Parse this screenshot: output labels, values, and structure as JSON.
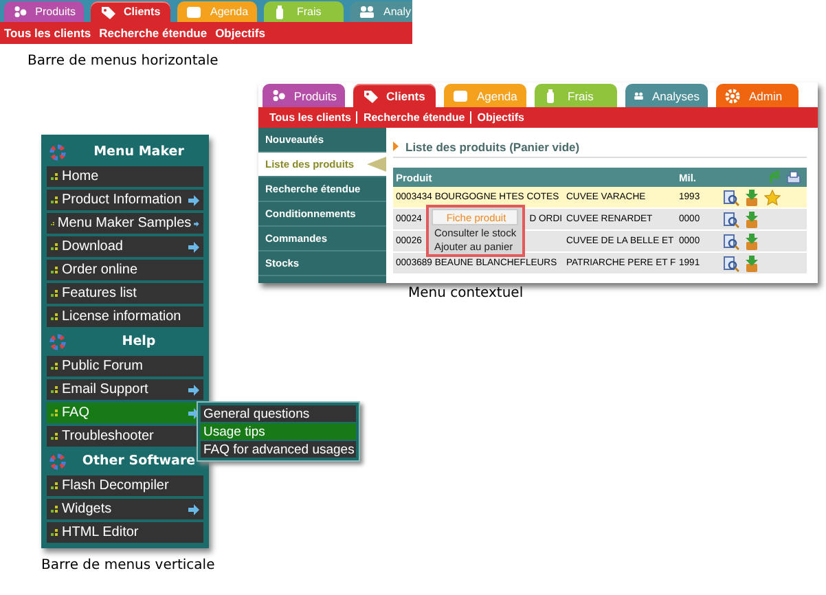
{
  "horizontal_menu": {
    "tabs": [
      {
        "label": "Produits",
        "color": "#b54ea6",
        "selected": false
      },
      {
        "label": "Clients",
        "color": "#d8282c",
        "selected": true
      },
      {
        "label": "Agenda",
        "color": "#f4a11e",
        "selected": false
      },
      {
        "label": "Frais",
        "color": "#8fc43c",
        "selected": false
      },
      {
        "label": "Analy",
        "color": "#4f8f98",
        "selected": false
      }
    ],
    "links": [
      "Tous les clients",
      "Recherche étendue",
      "Objectifs"
    ],
    "caption": "Barre de menus horizontale"
  },
  "context_menu_demo": {
    "tabs": [
      {
        "label": "Produits",
        "color": "#b54ea6",
        "selected": false
      },
      {
        "label": "Clients",
        "color": "#d8282c",
        "selected": true
      },
      {
        "label": "Agenda",
        "color": "#f4a11e",
        "selected": false
      },
      {
        "label": "Frais",
        "color": "#8fc43c",
        "selected": false
      },
      {
        "label": "Analyses",
        "color": "#4f8f98",
        "selected": false
      },
      {
        "label": "Admin",
        "color": "#f0650f",
        "selected": false
      }
    ],
    "links": [
      "Tous les clients",
      "Recherche étendue",
      "Objectifs"
    ],
    "sidebar": [
      {
        "label": "Nouveautés",
        "selected": false
      },
      {
        "label": "Liste des produits",
        "selected": true
      },
      {
        "label": "Recherche étendue",
        "selected": false
      },
      {
        "label": "Conditionnements",
        "selected": false
      },
      {
        "label": "Commandes",
        "selected": false
      },
      {
        "label": "Stocks",
        "selected": false
      }
    ],
    "section_title": "Liste des produits (Panier vide)",
    "table": {
      "columns": [
        "Produit",
        "Mil."
      ],
      "rows": [
        {
          "product": [
            "0003434 BOURGOGNE HTES COTES"
          ],
          "cuvee": "CUVEE VARACHE",
          "year": "1993",
          "highlighted": true,
          "starred": true
        },
        {
          "product": [
            "00024",
            "D ORDI"
          ],
          "cuvee": "CUVEE RENARDET",
          "year": "0000",
          "highlighted": false,
          "starred": false
        },
        {
          "product": [
            "00026"
          ],
          "cuvee": "CUVEE DE LA BELLE ET",
          "year": "0000",
          "highlighted": false,
          "starred": false
        },
        {
          "product": [
            "0003689 BEAUNE BLANCHEFLEURS"
          ],
          "cuvee": "PATRIARCHE PERE ET F",
          "year": "1991",
          "highlighted": false,
          "starred": false
        }
      ]
    },
    "context_menu": [
      {
        "label": "Fiche produit",
        "selected": true
      },
      {
        "label": "Consulter le stock",
        "selected": false
      },
      {
        "label": "Ajouter au panier",
        "selected": false
      }
    ],
    "caption": "Menu contextuel"
  },
  "vertical_menu": {
    "sections": [
      {
        "title": "Menu Maker",
        "items": [
          {
            "label": "Home",
            "has_submenu": false,
            "selected": false
          },
          {
            "label": "Product Information",
            "has_submenu": true,
            "selected": false
          },
          {
            "label": "Menu Maker Samples",
            "has_submenu": true,
            "selected": false
          },
          {
            "label": "Download",
            "has_submenu": true,
            "selected": false
          },
          {
            "label": "Order online",
            "has_submenu": false,
            "selected": false
          },
          {
            "label": "Features list",
            "has_submenu": false,
            "selected": false
          },
          {
            "label": "License information",
            "has_submenu": false,
            "selected": false
          }
        ]
      },
      {
        "title": "Help",
        "items": [
          {
            "label": "Public Forum",
            "has_submenu": false,
            "selected": false
          },
          {
            "label": "Email Support",
            "has_submenu": true,
            "selected": false
          },
          {
            "label": "FAQ",
            "has_submenu": true,
            "selected": true,
            "submenu": [
              {
                "label": "General questions",
                "selected": false
              },
              {
                "label": "Usage tips",
                "selected": true
              },
              {
                "label": "FAQ for advanced usages",
                "selected": false
              }
            ]
          },
          {
            "label": "Troubleshooter",
            "has_submenu": false,
            "selected": false
          }
        ]
      },
      {
        "title": "Other Software",
        "items": [
          {
            "label": "Flash Decompiler",
            "has_submenu": false,
            "selected": false
          },
          {
            "label": "Widgets",
            "has_submenu": true,
            "selected": false
          },
          {
            "label": "HTML Editor",
            "has_submenu": false,
            "selected": false
          }
        ]
      }
    ],
    "caption": "Barre de menus verticale"
  }
}
